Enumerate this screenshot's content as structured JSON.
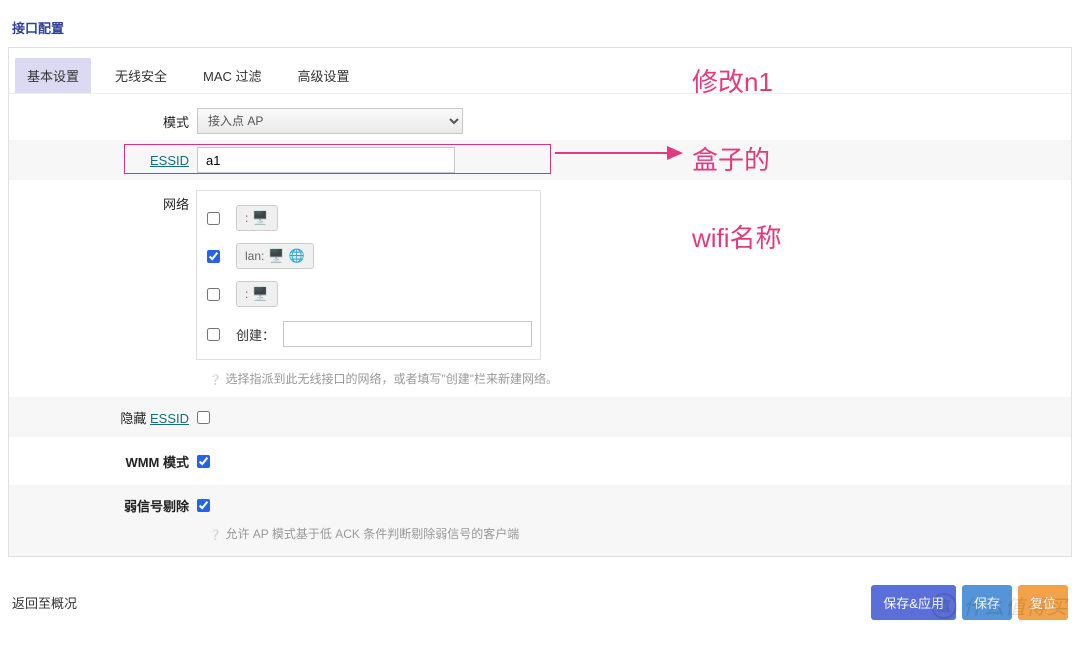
{
  "section_title": "接口配置",
  "tabs": [
    "基本设置",
    "无线安全",
    "MAC 过滤",
    "高级设置"
  ],
  "active_tab": 0,
  "mode": {
    "label": "模式",
    "value": "接入点 AP"
  },
  "essid": {
    "label": "ESSID",
    "value": "a1"
  },
  "network": {
    "label": "网络",
    "items": [
      {
        "checked": false,
        "name": ":"
      },
      {
        "checked": true,
        "name": "lan:"
      },
      {
        "checked": false,
        "name": ":"
      }
    ],
    "create_label": "创建：",
    "create_value": ""
  },
  "network_hint": "选择指派到此无线接口的网络，或者填写\"创建\"栏来新建网络。",
  "hide_essid": {
    "prefix": "隐藏 ",
    "link": "ESSID",
    "checked": false
  },
  "wmm": {
    "label": "WMM 模式",
    "checked": true
  },
  "weak_signal": {
    "label": "弱信号剔除",
    "checked": true
  },
  "weak_hint": "允许 AP 模式基于低 ACK 条件判断剔除弱信号的客户端",
  "footer": {
    "back": "返回至概况",
    "save_apply": "保存&应用",
    "save": "保存",
    "reset": "复位"
  },
  "annotations": {
    "l1": "修改n1",
    "l2": "盒子的",
    "l3": "wifi名称"
  },
  "watermark": {
    "icon": "值",
    "text": "什么值得买"
  }
}
